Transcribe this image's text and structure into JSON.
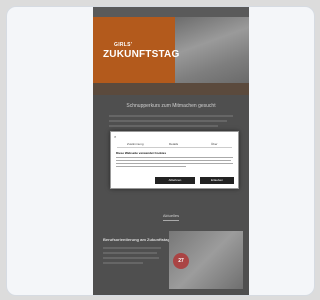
{
  "hero": {
    "badge": "GIRLS'",
    "title": "ZUKUNFTSTAG"
  },
  "section": {
    "heading": "Schnupperkurs zum Mitmachen gesucht"
  },
  "consent": {
    "close": "×",
    "tabs": [
      "Zustimmung",
      "Details",
      "Über"
    ],
    "title": "Diese Webseite verwendet Cookies",
    "buttons": {
      "deny": "Ablehnen",
      "allow": "Erlauben"
    }
  },
  "bottom_section": {
    "heading": "Aktuelles"
  },
  "card": {
    "title": "Berufsorientierung am Zukunftstag",
    "badge_number": "27"
  },
  "colors": {
    "hero_orange": "#b35a1c",
    "overlay": "#4f4f4f",
    "modal_bg": "#ffffff",
    "button": "#222222"
  }
}
